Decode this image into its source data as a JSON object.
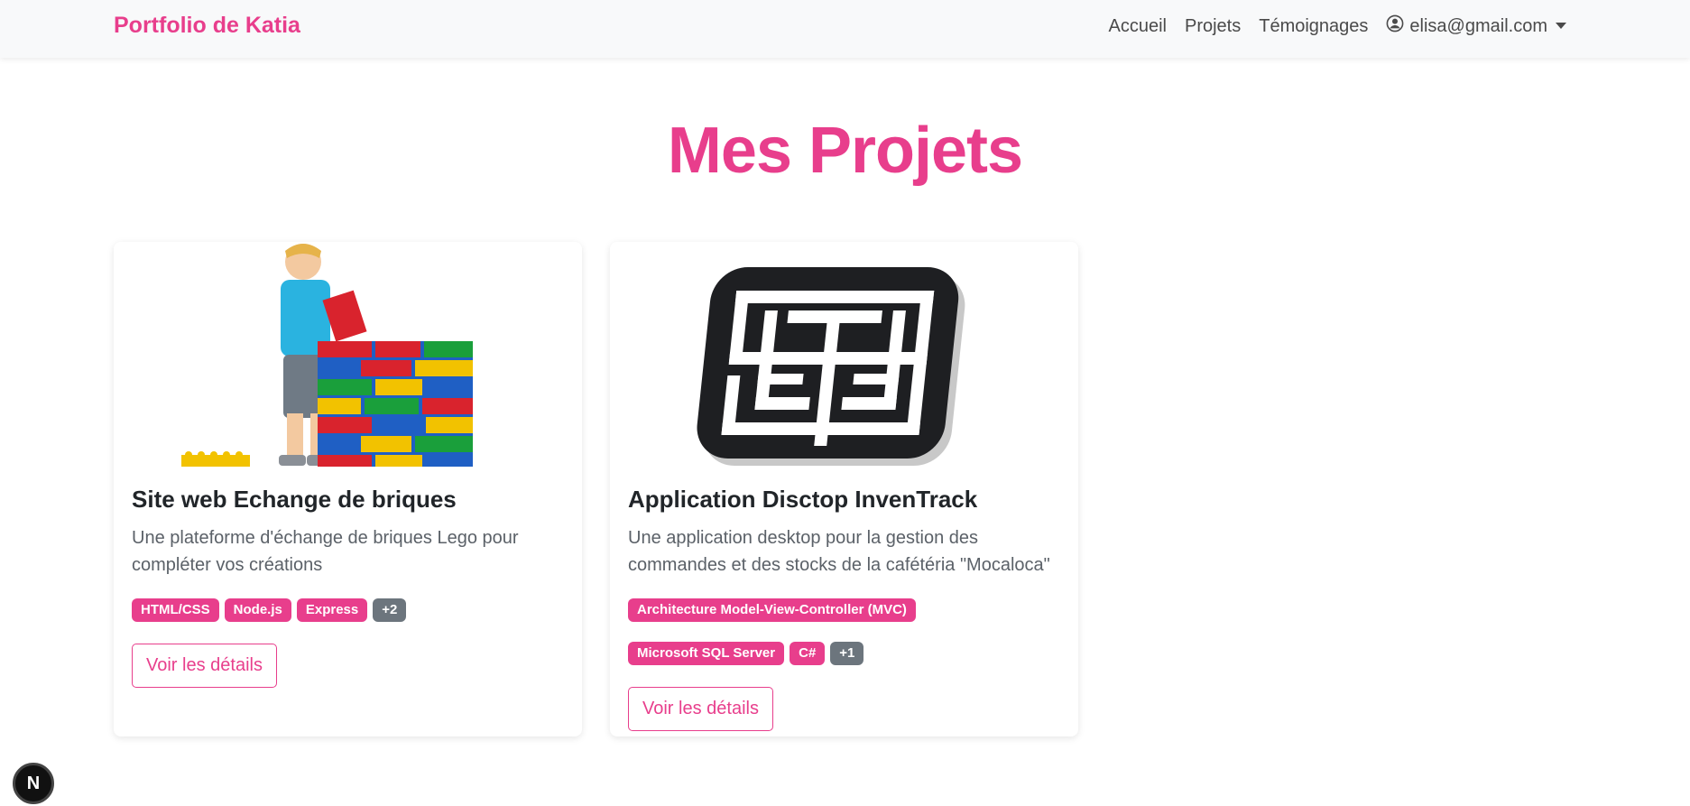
{
  "navbar": {
    "brand": "Portfolio de Katia",
    "links": [
      "Accueil",
      "Projets",
      "Témoignages"
    ],
    "user_email": "elisa@gmail.com"
  },
  "page": {
    "title": "Mes Projets"
  },
  "projects": [
    {
      "title": "Site web Echange de briques",
      "description": "Une plateforme d'échange de briques Lego pour compléter vos créations",
      "tags": [
        "HTML/CSS",
        "Node.js",
        "Express"
      ],
      "more": "+2",
      "button": "Voir les détails"
    },
    {
      "title": "Application Disctop InvenTrack",
      "description": "Une application desktop pour la gestion des commandes et des stocks de la cafétéria \"Mocaloca\"",
      "tags": [
        "Architecture Model-View-Controller (MVC)",
        "Microsoft SQL Server",
        "C#"
      ],
      "more": "+1",
      "button": "Voir les détails"
    }
  ],
  "dev_badge": "N",
  "colors": {
    "accent": "#e83e8c",
    "muted_badge": "#6c757d",
    "navbar_bg": "#f8f9fa"
  }
}
